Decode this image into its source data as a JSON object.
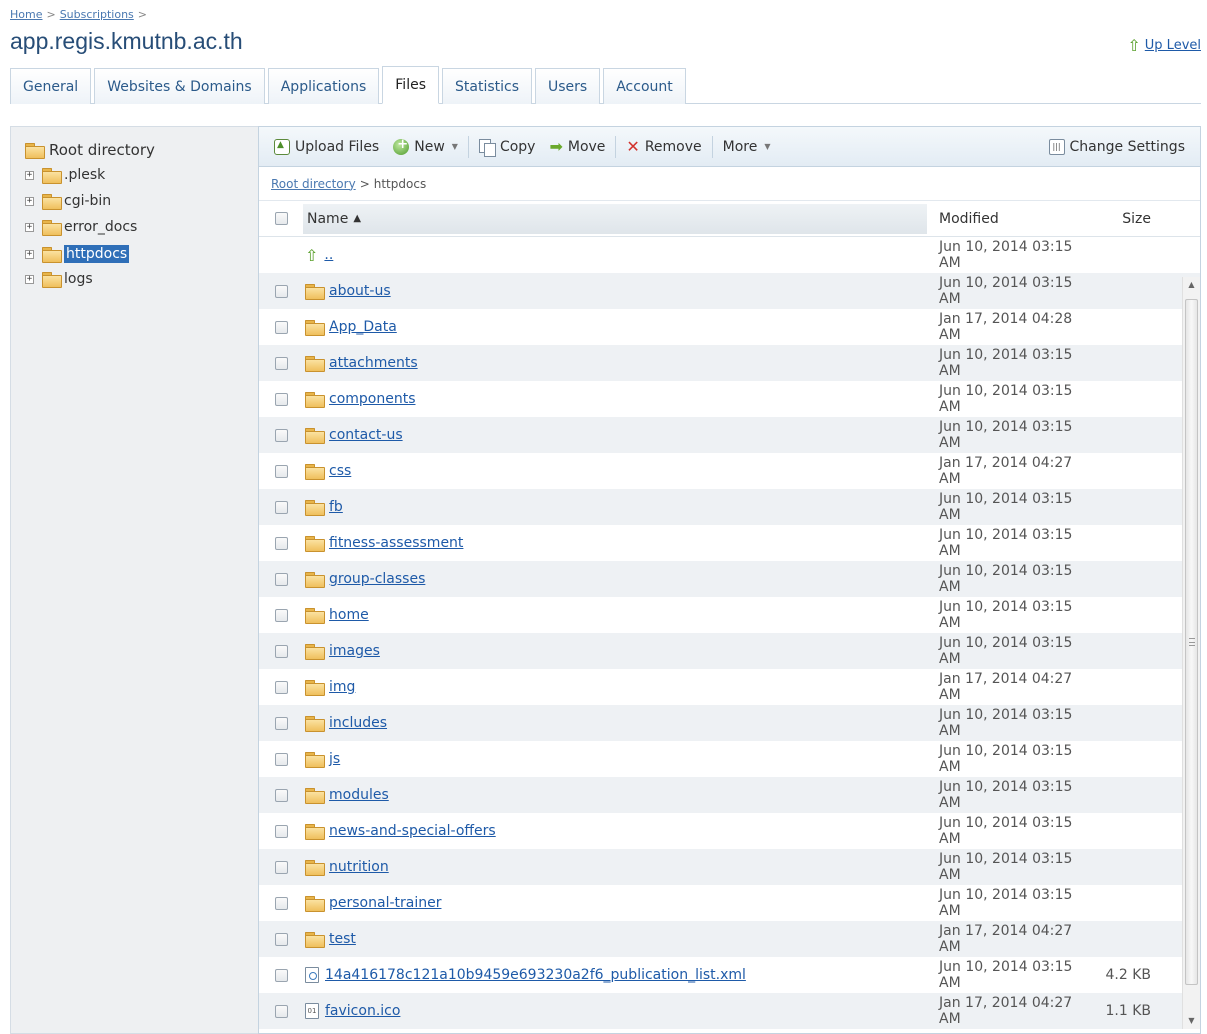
{
  "breadcrumb": {
    "items": [
      "Home",
      "Subscriptions"
    ],
    "separator": ">"
  },
  "page_title": "app.regis.kmutnb.ac.th",
  "up_level": "Up Level",
  "tabs": [
    {
      "label": "General"
    },
    {
      "label": "Websites & Domains"
    },
    {
      "label": "Applications"
    },
    {
      "label": "Files",
      "active": true
    },
    {
      "label": "Statistics"
    },
    {
      "label": "Users"
    },
    {
      "label": "Account"
    }
  ],
  "tree": {
    "root": "Root directory",
    "items": [
      {
        "label": ".plesk"
      },
      {
        "label": "cgi-bin"
      },
      {
        "label": "error_docs"
      },
      {
        "label": "httpdocs",
        "selected": true
      },
      {
        "label": "logs"
      }
    ]
  },
  "toolbar": {
    "upload": "Upload Files",
    "new": "New",
    "copy": "Copy",
    "move": "Move",
    "remove": "Remove",
    "more": "More",
    "change_settings": "Change Settings"
  },
  "path": {
    "root": "Root directory",
    "separator": ">",
    "current": "httpdocs"
  },
  "table": {
    "headers": {
      "name": "Name",
      "modified": "Modified",
      "size": "Size"
    },
    "parent_row": {
      "name": "..",
      "modified": "Jun 10, 2014 03:15 AM"
    },
    "rows": [
      {
        "name": "about-us",
        "modified": "Jun 10, 2014 03:15 AM",
        "size": "",
        "type": "folder"
      },
      {
        "name": "App_Data",
        "modified": "Jan 17, 2014 04:28 AM",
        "size": "",
        "type": "folder"
      },
      {
        "name": "attachments",
        "modified": "Jun 10, 2014 03:15 AM",
        "size": "",
        "type": "folder"
      },
      {
        "name": "components",
        "modified": "Jun 10, 2014 03:15 AM",
        "size": "",
        "type": "folder"
      },
      {
        "name": "contact-us",
        "modified": "Jun 10, 2014 03:15 AM",
        "size": "",
        "type": "folder"
      },
      {
        "name": "css",
        "modified": "Jan 17, 2014 04:27 AM",
        "size": "",
        "type": "folder"
      },
      {
        "name": "fb",
        "modified": "Jun 10, 2014 03:15 AM",
        "size": "",
        "type": "folder"
      },
      {
        "name": "fitness-assessment",
        "modified": "Jun 10, 2014 03:15 AM",
        "size": "",
        "type": "folder"
      },
      {
        "name": "group-classes",
        "modified": "Jun 10, 2014 03:15 AM",
        "size": "",
        "type": "folder"
      },
      {
        "name": "home",
        "modified": "Jun 10, 2014 03:15 AM",
        "size": "",
        "type": "folder"
      },
      {
        "name": "images",
        "modified": "Jun 10, 2014 03:15 AM",
        "size": "",
        "type": "folder"
      },
      {
        "name": "img",
        "modified": "Jan 17, 2014 04:27 AM",
        "size": "",
        "type": "folder"
      },
      {
        "name": "includes",
        "modified": "Jun 10, 2014 03:15 AM",
        "size": "",
        "type": "folder"
      },
      {
        "name": "js",
        "modified": "Jun 10, 2014 03:15 AM",
        "size": "",
        "type": "folder"
      },
      {
        "name": "modules",
        "modified": "Jun 10, 2014 03:15 AM",
        "size": "",
        "type": "folder"
      },
      {
        "name": "news-and-special-offers",
        "modified": "Jun 10, 2014 03:15 AM",
        "size": "",
        "type": "folder"
      },
      {
        "name": "nutrition",
        "modified": "Jun 10, 2014 03:15 AM",
        "size": "",
        "type": "folder"
      },
      {
        "name": "personal-trainer",
        "modified": "Jun 10, 2014 03:15 AM",
        "size": "",
        "type": "folder"
      },
      {
        "name": "test",
        "modified": "Jan 17, 2014 04:27 AM",
        "size": "",
        "type": "folder"
      },
      {
        "name": "14a416178c121a10b9459e693230a2f6_publication_list.xml",
        "modified": "Jun 10, 2014 03:15 AM",
        "size": "4.2 KB",
        "type": "xml"
      },
      {
        "name": "favicon.ico",
        "modified": "Jan 17, 2014 04:27 AM",
        "size": "1.1 KB",
        "type": "file"
      }
    ]
  },
  "icons": {
    "folder": "folder-icon",
    "up": "up-arrow-icon",
    "upload": "upload-icon",
    "new": "plus-circle-icon",
    "copy": "copy-icon",
    "move": "arrow-right-icon",
    "remove": "x-icon",
    "settings": "columns-icon"
  },
  "colors": {
    "accent": "#2f6fb8",
    "link": "#1e5aa8",
    "title": "#274d77"
  }
}
